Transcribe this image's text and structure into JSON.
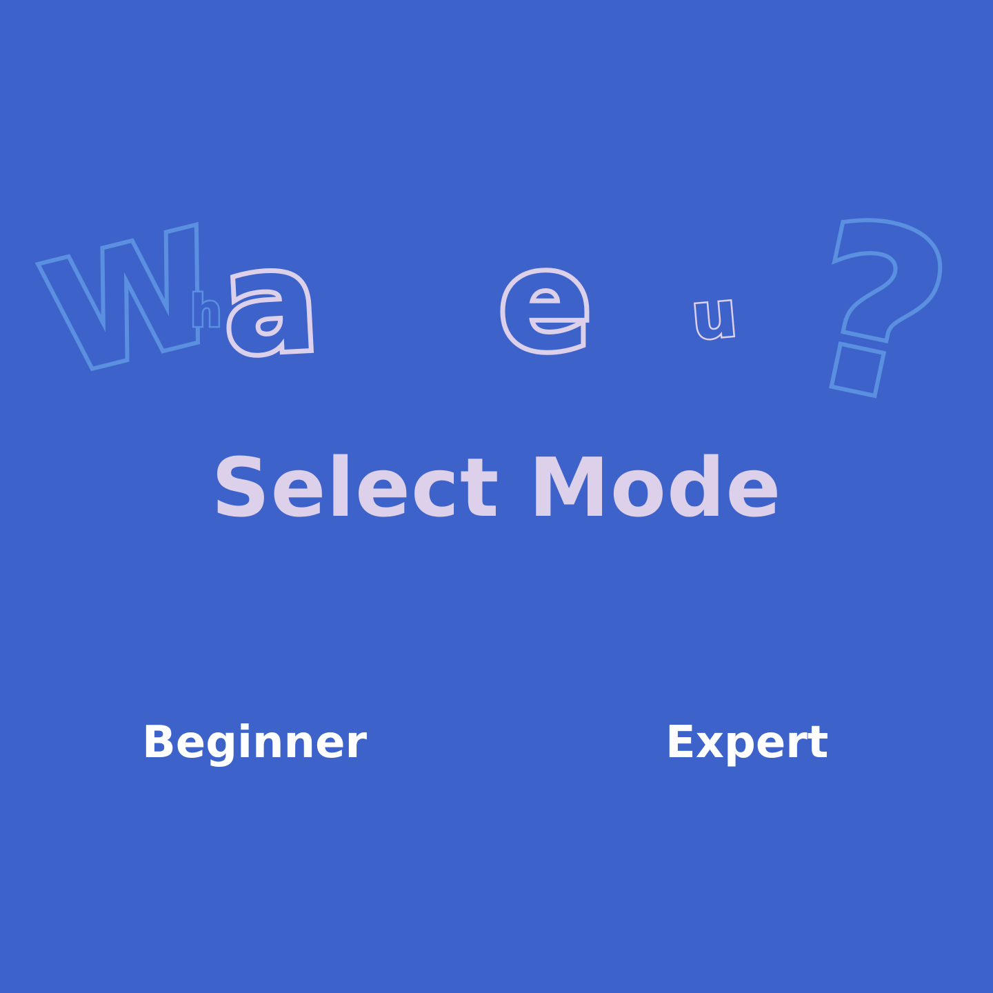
{
  "logo": {
    "letters": [
      "W",
      "h",
      "a",
      "e",
      "u",
      "?"
    ]
  },
  "title": "Select Mode",
  "modes": {
    "beginner_label": "Beginner",
    "expert_label": "Expert"
  },
  "colors": {
    "background": "#3d63cb",
    "outline_light": "#ddd0ea",
    "outline_blue": "#5b8fe0",
    "button_text": "#ffffff"
  }
}
